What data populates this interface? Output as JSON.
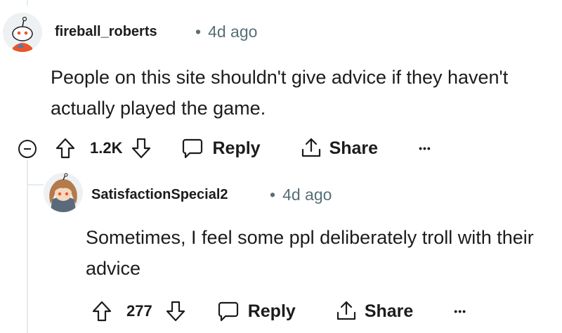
{
  "comments": [
    {
      "username": "fireball_roberts",
      "separator": "•",
      "age": "4d ago",
      "body": "People on this site shouldn't give advice if they haven't actually played the game.",
      "votes": "1.2K",
      "reply_label": "Reply",
      "share_label": "Share",
      "more_label": "•••",
      "avatar_icon": "snoo-avatar-icon"
    },
    {
      "username": "SatisfactionSpecial2",
      "separator": "•",
      "age": "4d ago",
      "body": "Sometimes, I feel some ppl deliberately troll with their advice",
      "votes": "277",
      "reply_label": "Reply",
      "share_label": "Share",
      "more_label": "•••",
      "avatar_icon": "anime-girl-avatar-icon"
    }
  ],
  "colors": {
    "text": "#1c1c1c",
    "meta": "#576f76",
    "thread_line": "#e5ebee"
  }
}
